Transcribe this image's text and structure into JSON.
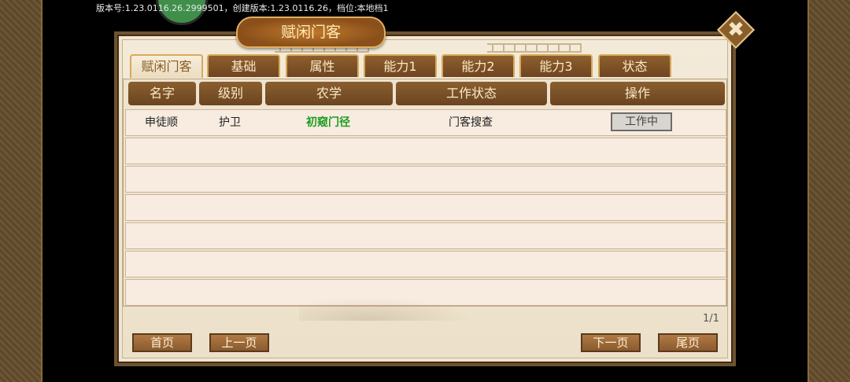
{
  "version_text": "版本号:1.23.0116.26.2999501，创建版本:1.23.0116.26，档位:本地档1",
  "dialog": {
    "title": "赋闲门客",
    "close_icon_glyph": "✖"
  },
  "tabs": [
    {
      "label": "赋闲门客",
      "active": true
    },
    {
      "label": "基础",
      "active": false
    },
    {
      "label": "属性",
      "active": false
    },
    {
      "label": "能力1",
      "active": false
    },
    {
      "label": "能力2",
      "active": false
    },
    {
      "label": "能力3",
      "active": false
    },
    {
      "label": "状态",
      "active": false
    }
  ],
  "table": {
    "headers": [
      "名字",
      "级别",
      "农学",
      "工作状态",
      "操作"
    ],
    "rows": [
      {
        "name": "申徒顺",
        "level": "护卫",
        "agronomy": "初窥门径",
        "work_status": "门客搜查",
        "action": "工作中"
      }
    ]
  },
  "pagination": {
    "page_info": "1/1",
    "first": "首页",
    "prev": "上一页",
    "next": "下一页",
    "last": "尾页"
  },
  "colors": {
    "frame": "#6e5330",
    "tab_bg": "#7b4f24",
    "agronomy_text": "#1f9a1f"
  }
}
